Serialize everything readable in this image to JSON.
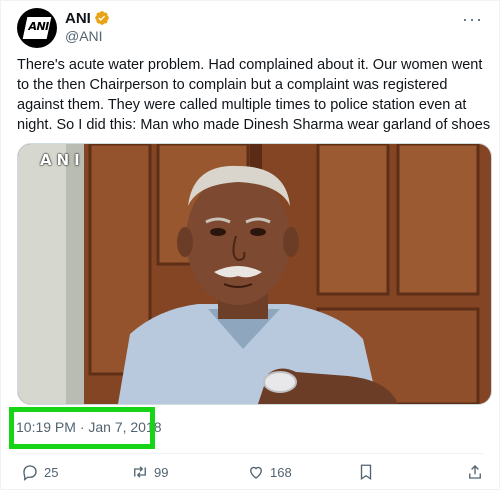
{
  "author": {
    "name": "ANI",
    "handle": "@ANI",
    "avatar_text": "ANI"
  },
  "tweet": {
    "text": "There's acute water problem. Had complained about it. Our women went to the then Chairperson to complain but a complaint was registered against them. They were called multiple times to police station even at night. So I did this: Man who made Dinesh Sharma wear garland of shoes",
    "timestamp": "10:19 PM · Jan 7, 2018",
    "media_watermark": "ANI"
  },
  "actions": {
    "replies": "25",
    "retweets": "99",
    "likes": "168"
  },
  "colors": {
    "highlight": "#16d416",
    "verified_badge": "#e8a317",
    "secondary_text": "#536471"
  }
}
